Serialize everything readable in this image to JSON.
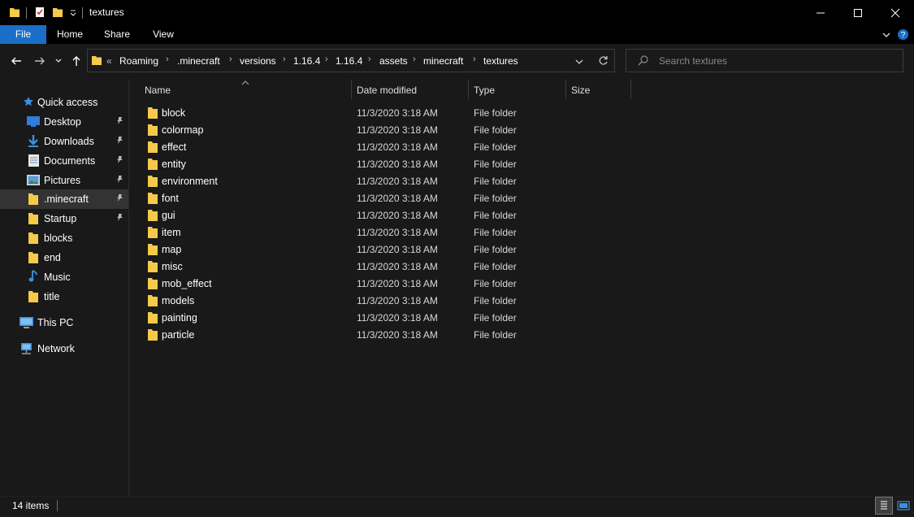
{
  "window": {
    "title": "textures"
  },
  "ribbon": {
    "tabs": [
      "File",
      "Home",
      "Share",
      "View"
    ]
  },
  "address": {
    "overflow": "«",
    "crumbs": [
      "Roaming",
      ".minecraft",
      "versions",
      "1.16.4",
      "1.16.4",
      "assets",
      "minecraft",
      "textures"
    ]
  },
  "search": {
    "placeholder": "Search textures"
  },
  "sidebar": {
    "quick_access": "Quick access",
    "items": [
      {
        "label": "Desktop",
        "icon": "desktop-icon",
        "pinned": true
      },
      {
        "label": "Downloads",
        "icon": "downloads-icon",
        "pinned": true
      },
      {
        "label": "Documents",
        "icon": "documents-icon",
        "pinned": true
      },
      {
        "label": "Pictures",
        "icon": "pictures-icon",
        "pinned": true
      },
      {
        "label": ".minecraft",
        "icon": "folder-icon",
        "pinned": true,
        "selected": true
      },
      {
        "label": "Startup",
        "icon": "folder-icon",
        "pinned": true
      },
      {
        "label": "blocks",
        "icon": "folder-icon",
        "pinned": false
      },
      {
        "label": "end",
        "icon": "folder-icon",
        "pinned": false
      },
      {
        "label": "Music",
        "icon": "music-icon",
        "pinned": false
      },
      {
        "label": "title",
        "icon": "folder-icon",
        "pinned": false
      }
    ],
    "this_pc": "This PC",
    "network": "Network"
  },
  "columns": {
    "name": "Name",
    "date_modified": "Date modified",
    "type": "Type",
    "size": "Size"
  },
  "files": [
    {
      "name": "block",
      "date": "11/3/2020 3:18 AM",
      "type": "File folder"
    },
    {
      "name": "colormap",
      "date": "11/3/2020 3:18 AM",
      "type": "File folder"
    },
    {
      "name": "effect",
      "date": "11/3/2020 3:18 AM",
      "type": "File folder"
    },
    {
      "name": "entity",
      "date": "11/3/2020 3:18 AM",
      "type": "File folder"
    },
    {
      "name": "environment",
      "date": "11/3/2020 3:18 AM",
      "type": "File folder"
    },
    {
      "name": "font",
      "date": "11/3/2020 3:18 AM",
      "type": "File folder"
    },
    {
      "name": "gui",
      "date": "11/3/2020 3:18 AM",
      "type": "File folder"
    },
    {
      "name": "item",
      "date": "11/3/2020 3:18 AM",
      "type": "File folder"
    },
    {
      "name": "map",
      "date": "11/3/2020 3:18 AM",
      "type": "File folder"
    },
    {
      "name": "misc",
      "date": "11/3/2020 3:18 AM",
      "type": "File folder"
    },
    {
      "name": "mob_effect",
      "date": "11/3/2020 3:18 AM",
      "type": "File folder"
    },
    {
      "name": "models",
      "date": "11/3/2020 3:18 AM",
      "type": "File folder"
    },
    {
      "name": "painting",
      "date": "11/3/2020 3:18 AM",
      "type": "File folder"
    },
    {
      "name": "particle",
      "date": "11/3/2020 3:18 AM",
      "type": "File folder"
    }
  ],
  "status": {
    "item_count": "14 items"
  },
  "colors": {
    "accent": "#1a6ec7",
    "folder": "#f5c94a",
    "background": "#191919"
  }
}
